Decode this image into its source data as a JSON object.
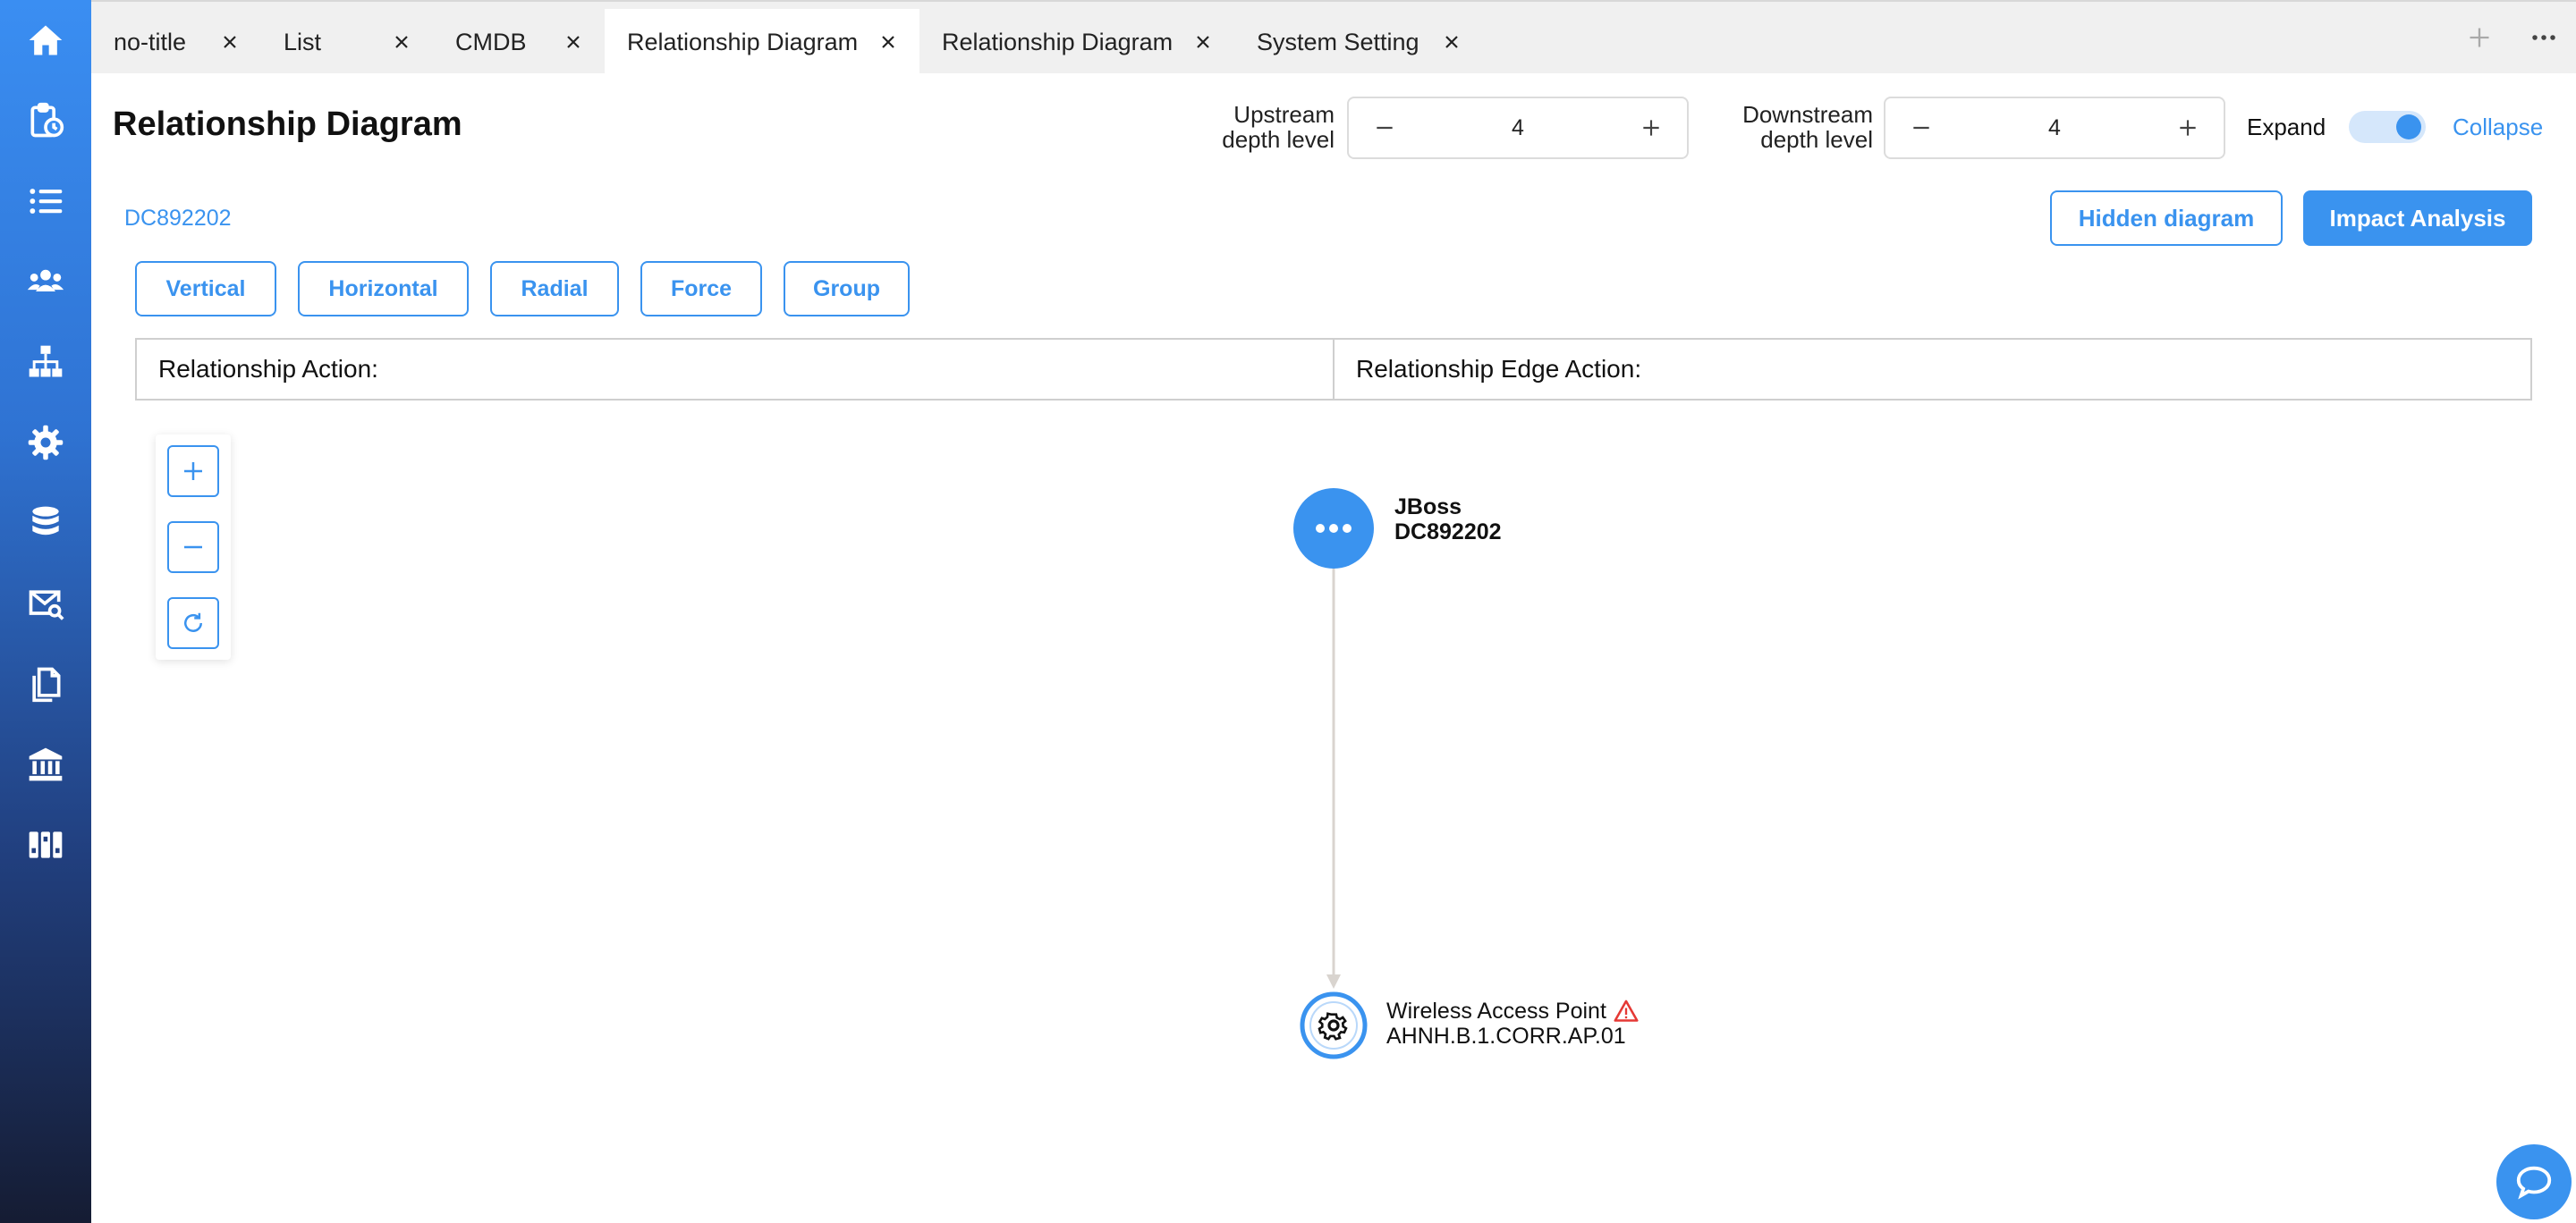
{
  "tabs": [
    {
      "label": "no-title"
    },
    {
      "label": "List"
    },
    {
      "label": "CMDB"
    },
    {
      "label": "Relationship Diagram"
    },
    {
      "label": "Relationship Diagram"
    },
    {
      "label": "System Setting"
    }
  ],
  "header": {
    "title": "Relationship Diagram",
    "upstream_label_1": "Upstream",
    "upstream_label_2": "depth level",
    "upstream_value": "4",
    "downstream_label_1": "Downstream",
    "downstream_label_2": "depth level",
    "downstream_value": "4",
    "expand_label": "Expand",
    "collapse_label": "Collapse"
  },
  "toolbar": {
    "ci_id": "DC892202",
    "hidden_diagram_label": "Hidden diagram",
    "impact_analysis_label": "Impact Analysis",
    "layouts": [
      "Vertical",
      "Horizontal",
      "Radial",
      "Force",
      "Group"
    ]
  },
  "actions": {
    "relationship_action": "Relationship Action:",
    "relationship_edge_action": "Relationship Edge Action:"
  },
  "diagram": {
    "nodes": [
      {
        "title": "JBoss",
        "subtitle": "DC892202",
        "icon": "more-dots-icon"
      },
      {
        "title": "Wireless Access Point",
        "subtitle": "AHNH.B.1.CORR.AP.01",
        "icon": "gear-icon",
        "badge": "warning-triangle-icon"
      }
    ]
  },
  "colors": {
    "accent": "#3a93ef",
    "warning": "#e53935",
    "sidebar_top": "#3a8ef2",
    "sidebar_bottom": "#151c33"
  }
}
